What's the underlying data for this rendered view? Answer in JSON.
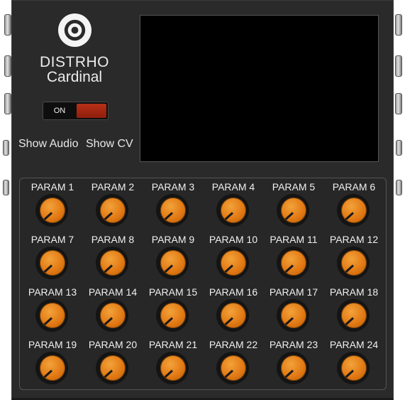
{
  "module": {
    "brand_line1": "DISTRHO",
    "brand_line2": "Cardinal",
    "toggle_label": "ON",
    "show_audio_label": "Show Audio",
    "show_cv_label": "Show CV"
  },
  "params": [
    "PARAM 1",
    "PARAM 2",
    "PARAM 3",
    "PARAM 4",
    "PARAM 5",
    "PARAM 6",
    "PARAM 7",
    "PARAM 8",
    "PARAM 9",
    "PARAM 10",
    "PARAM 11",
    "PARAM 12",
    "PARAM 13",
    "PARAM 14",
    "PARAM 15",
    "PARAM 16",
    "PARAM 17",
    "PARAM 18",
    "PARAM 19",
    "PARAM 20",
    "PARAM 21",
    "PARAM 22",
    "PARAM 23",
    "PARAM 24"
  ],
  "colors": {
    "panel": "#2a2a2a",
    "knob": "#e27914",
    "toggle_on": "#a8270f"
  }
}
